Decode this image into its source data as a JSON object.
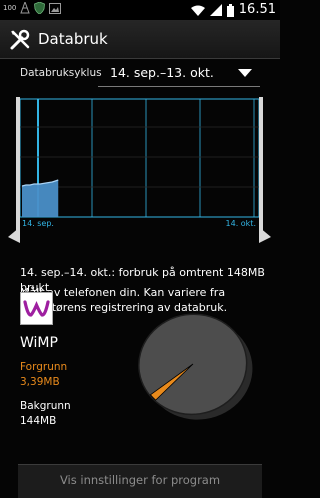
{
  "status_bar": {
    "notification_count": "100",
    "time": "16.51",
    "icons": [
      "vlc-cone-icon",
      "shield-icon",
      "image-icon",
      "wifi-icon",
      "signal-icon",
      "battery-icon"
    ]
  },
  "action_bar": {
    "title": "Databruk",
    "icon": "wrench-screwdriver-icon",
    "menu_icon": "overflow-menu-icon"
  },
  "cycle": {
    "label": "Databruksyklus",
    "selected": "14. sep.–13. okt."
  },
  "chart_data": {
    "type": "area",
    "x_start_label": "14. sep.",
    "x_end_label": "14. okt.",
    "usage_fraction_of_period": [
      0.0,
      0.16
    ],
    "colors": {
      "grid": "#33b5e5",
      "fill": "#4a8fc8"
    }
  },
  "summary": "14. sep.–14. okt.: forbruk på omtrent 148MB brukt",
  "disclaimer": "Målt av telefonen din. Kan variere fra operatørens registrering av databruk.",
  "app": {
    "name": "WiMP",
    "icon": "wimp-logo-icon",
    "foreground_label": "Forgrunn",
    "foreground_value": "3,39MB",
    "background_label": "Bakgrunn",
    "background_value": "144MB",
    "foreground_mb": 3.39,
    "background_mb": 144,
    "colors": {
      "foreground": "#e88a1c",
      "background": "#4d4d4d"
    }
  },
  "settings_button": "Vis innstillinger for program"
}
